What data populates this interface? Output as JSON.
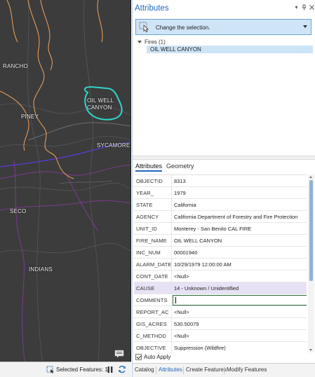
{
  "map": {
    "labels": {
      "rancho": "RANCHO",
      "oil_well_canyon": "OIL WELL CANYON",
      "piney": "PINEY",
      "sycamore": "SYCAMORE",
      "seco": "SECO",
      "indians": "INDIANS"
    },
    "colors": {
      "background": "#3c3c3c",
      "selection_outline": "#30d5c8",
      "roads": "#f2a35c",
      "boundaries": "#8a3b8a",
      "highway": "#5a3bd8"
    }
  },
  "statusbar": {
    "selected_features": "Selected Features: 1",
    "icons": [
      "selection-icon",
      "pause-icon",
      "refresh-icon"
    ]
  },
  "pane": {
    "title": "Attributes",
    "header_icons": [
      "dropdown-icon",
      "pin-icon",
      "close-icon"
    ],
    "selector_label": "Change the selection.",
    "tree": {
      "group_label": "Fires (1)",
      "item_label": "OIL WELL CANYON"
    },
    "tabs": {
      "attributes": "Attributes",
      "geometry": "Geometry"
    },
    "fields": [
      {
        "name": "OBJECTID",
        "value": "8313"
      },
      {
        "name": "YEAR_",
        "value": "1979"
      },
      {
        "name": "STATE",
        "value": "California"
      },
      {
        "name": "AGENCY",
        "value": "California Department of Forestry and Fire Protection"
      },
      {
        "name": "UNIT_ID",
        "value": "Monterey - San Benito CAL FIRE"
      },
      {
        "name": "FIRE_NAME",
        "value": "OIL WELL CANYON"
      },
      {
        "name": "INC_NUM",
        "value": "00001940"
      },
      {
        "name": "ALARM_DATE",
        "value": "10/29/1979 12:00:00 AM"
      },
      {
        "name": "CONT_DATE",
        "value": "<Null>"
      },
      {
        "name": "CAUSE",
        "value": "14 - Unknown / Unidentified"
      },
      {
        "name": "COMMENTS",
        "value": ""
      },
      {
        "name": "REPORT_AC",
        "value": "<Null>"
      },
      {
        "name": "GIS_ACRES",
        "value": "530.50079"
      },
      {
        "name": "C_METHOD",
        "value": "<Null>"
      },
      {
        "name": "OBJECTIVE",
        "value": "Suppression (Wildfire)"
      }
    ],
    "auto_apply_label": "Auto Apply",
    "auto_apply_checked": true,
    "bottom_tabs": [
      "Catalog",
      "Attributes",
      "Create Features",
      "Modify Features"
    ],
    "active_bottom_tab": "Attributes",
    "accent_color": "#1f68b7"
  }
}
